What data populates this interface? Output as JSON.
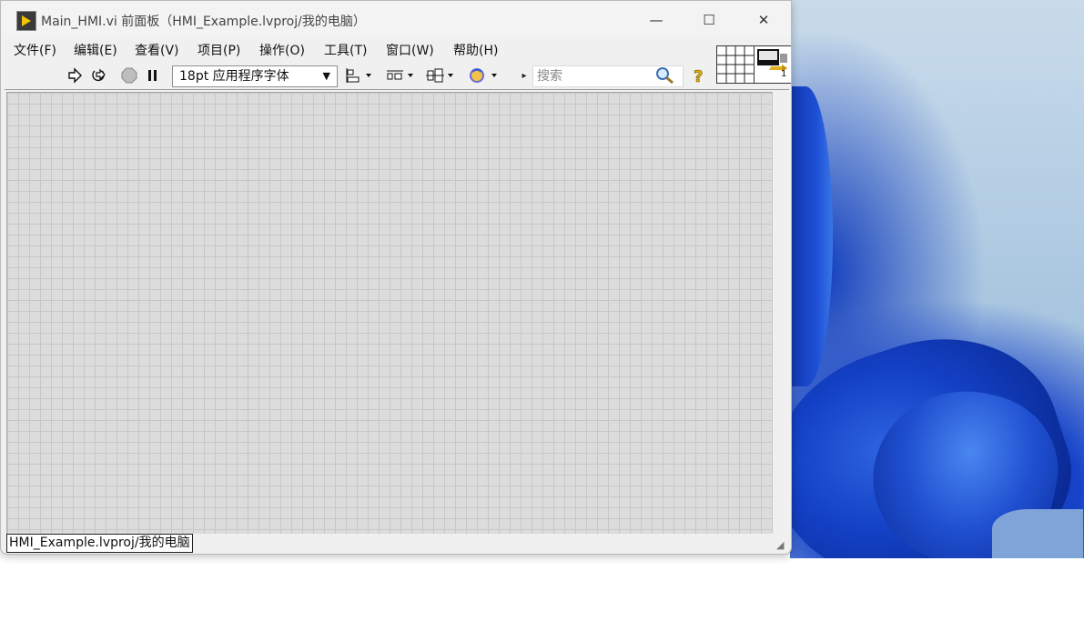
{
  "window": {
    "title": "Main_HMI.vi 前面板（HMI_Example.lvproj/我的电脑）"
  },
  "menubar": {
    "items": [
      {
        "label": "文件(F)"
      },
      {
        "label": "编辑(E)"
      },
      {
        "label": "查看(V)"
      },
      {
        "label": "项目(P)"
      },
      {
        "label": "操作(O)"
      },
      {
        "label": "工具(T)"
      },
      {
        "label": "窗口(W)"
      },
      {
        "label": "帮助(H)"
      }
    ]
  },
  "toolbar": {
    "font_select": "18pt 应用程序字体",
    "search_placeholder": "搜索",
    "icons": [
      "run-arrow-icon",
      "run-continuously-icon",
      "abort-icon",
      "pause-icon",
      "align-objects-icon",
      "distribute-objects-icon",
      "resize-objects-icon",
      "reorder-icon",
      "search-icon",
      "context-help-icon"
    ]
  },
  "vi_icon": {
    "connector_number": "1"
  },
  "status_bar": {
    "context": "HMI_Example.lvproj/我的电脑"
  },
  "colors": {
    "canvas": "#dcdcdc",
    "grid": "#c7c7c7",
    "window": "#f0f0f0"
  }
}
